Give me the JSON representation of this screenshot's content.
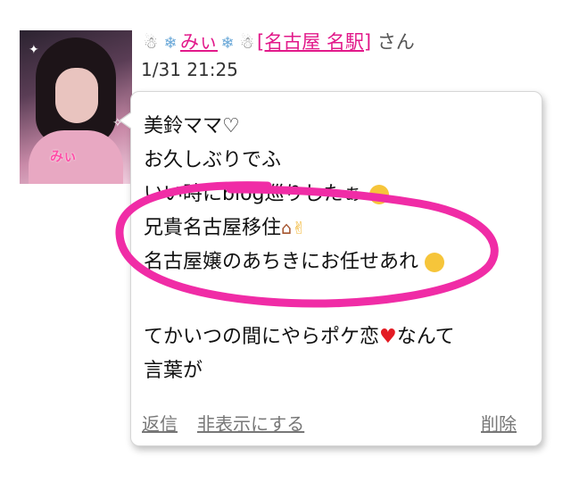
{
  "comment": {
    "avatar": {
      "label": "みぃ"
    },
    "header": {
      "name": "みぃ",
      "area": "[名古屋 名駅]",
      "suffix": "さん"
    },
    "timestamp": "1/31 21:25",
    "message_lines": [
      "美鈴ママ♡",
      "お久しぶりでふ",
      "いい時にblog巡りしたぁ",
      "兄貴名古屋移住",
      "名古屋嬢のあちきにお任せあれ",
      "",
      "てかいつの間にやらポケ恋",
      "なんて",
      "言葉が"
    ],
    "actions": {
      "reply": "返信",
      "hide": "非表示にする",
      "delete": "削除"
    }
  },
  "annotation": {
    "color": "#f02ca6"
  },
  "colors": {
    "link": "#e2198a",
    "action": "#777777",
    "border": "#d6d6d6"
  },
  "icons": [
    "snowman-icon",
    "snowflake-icon",
    "grinning-sweat-emoji",
    "house-emoji",
    "thumbs-up-emoji",
    "winking-face-emoji",
    "red-heart-emoji"
  ]
}
